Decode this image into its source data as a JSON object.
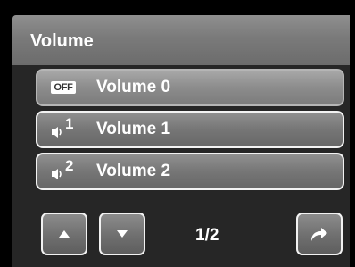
{
  "title": "Volume",
  "items": [
    {
      "icon": "sound-off-icon",
      "icon_text": "OFF",
      "label": "Volume 0",
      "selected": true
    },
    {
      "icon": "speaker-level-1-icon",
      "level": "1",
      "label": "Volume 1",
      "selected": false
    },
    {
      "icon": "speaker-level-2-icon",
      "level": "2",
      "label": "Volume 2",
      "selected": false
    }
  ],
  "page_indicator": "1/2",
  "buttons": {
    "up": "up-arrow-icon",
    "down": "down-arrow-icon",
    "back": "return-arrow-icon"
  }
}
